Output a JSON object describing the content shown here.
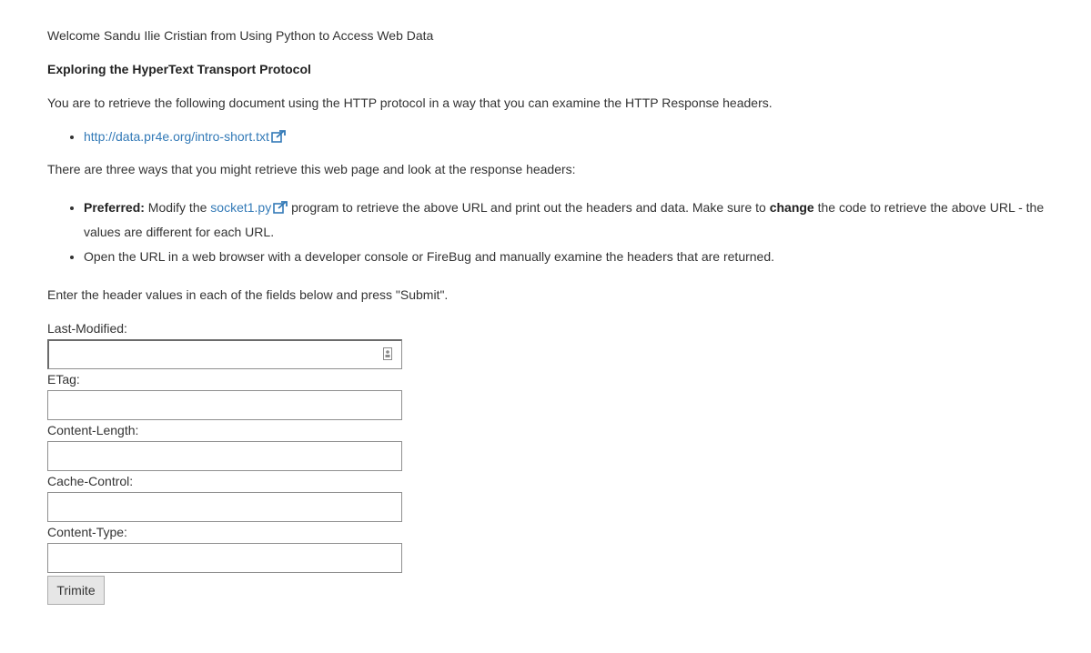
{
  "header": {
    "welcome": "Welcome Sandu Ilie Cristian from Using Python to Access Web Data",
    "title": "Exploring the HyperText Transport Protocol"
  },
  "intro": "You are to retrieve the following document using the HTTP protocol in a way that you can examine the HTTP Response headers.",
  "document_link": {
    "label": "http://data.pr4e.org/intro-short.txt",
    "icon": "external-link-icon"
  },
  "ways_intro": "There are three ways that you might retrieve this web page and look at the response headers:",
  "ways": {
    "preferred": {
      "bold_label": "Preferred:",
      "text_before_link": " Modify the ",
      "link_label": "socket1.py",
      "text_after_link": " program to retrieve the above URL and print out the headers and data. Make sure to ",
      "emphasis": "change",
      "text_end": " the code to retrieve the above URL - the values are different for each URL."
    },
    "browser": "Open the URL in a web browser with a developer console or FireBug and manually examine the headers that are returned."
  },
  "instructions": "Enter the header values in each of the fields below and press \"Submit\".",
  "form": {
    "fields": [
      {
        "label": "Last-Modified:",
        "value": ""
      },
      {
        "label": "ETag:",
        "value": ""
      },
      {
        "label": "Content-Length:",
        "value": ""
      },
      {
        "label": "Cache-Control:",
        "value": ""
      },
      {
        "label": "Content-Type:",
        "value": ""
      }
    ],
    "submit_label": "Trimite"
  },
  "colors": {
    "link": "#337ab7",
    "text": "#333333",
    "button_bg": "#e6e6e6"
  }
}
